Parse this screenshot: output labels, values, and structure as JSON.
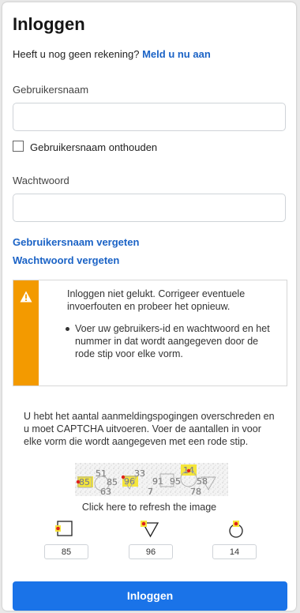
{
  "page": {
    "title": "Inloggen",
    "signup_prompt": "Heeft u nog geen rekening?",
    "signup_link": "Meld u nu aan"
  },
  "form": {
    "username_label": "Gebruikersnaam",
    "username_value": "",
    "remember_label": "Gebruikersnaam onthouden",
    "remember_checked": false,
    "password_label": "Wachtwoord",
    "password_value": "",
    "forgot_username": "Gebruikersnaam vergeten",
    "forgot_password": "Wachtwoord vergeten"
  },
  "alert": {
    "icon": "warning-icon",
    "color": "#f39a00",
    "message": "Inloggen niet gelukt. Corrigeer eventuele invoerfouten en probeer het opnieuw.",
    "items": [
      "Voer uw gebruikers-id en wachtwoord en het nummer in dat wordt aangegeven door de rode stip voor elke vorm."
    ]
  },
  "captcha": {
    "instructions": "U hebt het aantal aanmeldingspogingen overschreden en u moet CAPTCHA uitvoeren. Voer de aantallen in voor elke vorm die wordt aangegeven met een rode stip.",
    "image_numbers": [
      "85",
      "51",
      "85",
      "96",
      "33",
      "91",
      "95",
      "14",
      "58",
      "63",
      "7",
      "78"
    ],
    "refresh_text": "Click here to refresh the image",
    "shapes": [
      {
        "icon": "square-icon",
        "answer": "85"
      },
      {
        "icon": "triangle-icon",
        "answer": "96"
      },
      {
        "icon": "circle-icon",
        "answer": "14"
      }
    ]
  },
  "submit_label": "Inloggen",
  "colors": {
    "primary": "#1a73e8",
    "link": "#1b63c6",
    "warning": "#f39a00",
    "marker": "#e0201a",
    "highlight": "#f5e63a"
  }
}
